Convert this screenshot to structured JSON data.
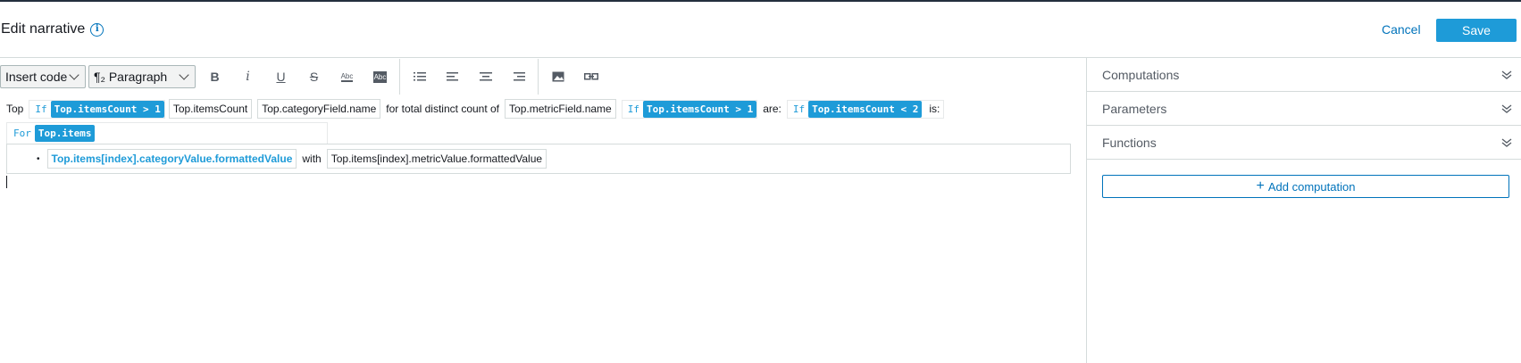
{
  "header": {
    "title": "Edit narrative",
    "cancel_label": "Cancel",
    "save_label": "Save"
  },
  "toolbar": {
    "insert_code": "Insert code",
    "paragraph": "¶₂ Paragraph",
    "bold": "B",
    "italic": "i",
    "underline": "U",
    "strike": "S",
    "abc": "Abc",
    "abc2": "Abc"
  },
  "editor": {
    "line1": {
      "top": "Top",
      "if1_kw": "If",
      "if1_cond": "Top.itemsCount > 1",
      "items_count": "Top.itemsCount",
      "category_field": "Top.categoryField.name",
      "for_total": "for total distinct count of",
      "metric_field": "Top.metricField.name",
      "if2_kw": "If",
      "if2_cond": "Top.itemsCount > 1",
      "are": "are:",
      "if3_kw": "If",
      "if3_cond": "Top.itemsCount < 2",
      "is": "is:"
    },
    "for_block": {
      "kw": "For",
      "var": "Top.items",
      "bullet": "•",
      "category_value": "Top.items[index].categoryValue.formattedValue",
      "with": "with",
      "metric_value": "Top.items[index].metricValue.formattedValue"
    }
  },
  "sidebar": {
    "sections": [
      "Computations",
      "Parameters",
      "Functions"
    ],
    "add_computation": "Add computation"
  }
}
